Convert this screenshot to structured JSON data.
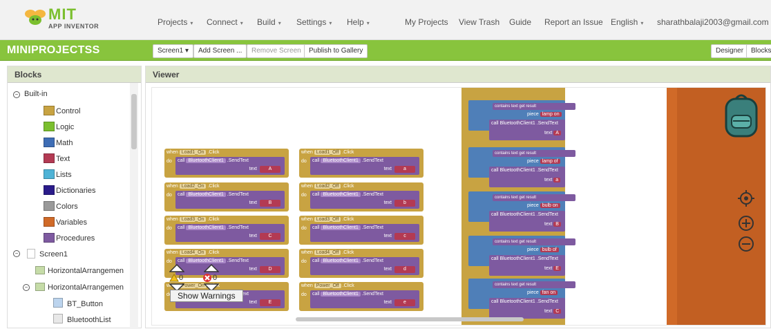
{
  "header": {
    "logo_title": "MIT",
    "logo_sub": "APP INVENTOR",
    "nav": [
      "Projects",
      "Connect",
      "Build",
      "Settings",
      "Help"
    ],
    "links": [
      "My Projects",
      "View Trash",
      "Guide",
      "Report an Issue"
    ],
    "language": "English",
    "account": "sharathbalaji2003@gmail.com"
  },
  "toolbar": {
    "project_name": "MINIPROJECTSS",
    "screen": "Screen1",
    "add_screen": "Add Screen ...",
    "remove_screen": "Remove Screen",
    "publish": "Publish to Gallery",
    "designer": "Designer",
    "blocks": "Blocks"
  },
  "blocks_panel": {
    "title": "Blocks",
    "builtin": "Built-in",
    "items": [
      {
        "label": "Control",
        "color": "#c8a342"
      },
      {
        "label": "Logic",
        "color": "#7bbf2e"
      },
      {
        "label": "Math",
        "color": "#3e6db5"
      },
      {
        "label": "Text",
        "color": "#b33a53"
      },
      {
        "label": "Lists",
        "color": "#4fb3d6"
      },
      {
        "label": "Dictionaries",
        "color": "#2a1b8a"
      },
      {
        "label": "Colors",
        "color": "#9a9a9a"
      },
      {
        "label": "Variables",
        "color": "#d06a28"
      },
      {
        "label": "Procedures",
        "color": "#7e5aa0"
      }
    ],
    "screen": "Screen1",
    "components": [
      "HorizontalArrangemen",
      "HorizontalArrangemen",
      "BT_Button",
      "BluetoothList"
    ]
  },
  "viewer": {
    "title": "Viewer",
    "events": [
      {
        "component": "Load1_On",
        "text": "A"
      },
      {
        "component": "Load1_Off",
        "text": "a"
      },
      {
        "component": "Load2_On",
        "text": "B"
      },
      {
        "component": "Load2_Off",
        "text": "b"
      },
      {
        "component": "Load3_On",
        "text": "C"
      },
      {
        "component": "Load3_Off",
        "text": "c"
      },
      {
        "component": "Load4_On",
        "text": "D"
      },
      {
        "component": "Load4_Off",
        "text": "d"
      },
      {
        "component": "Power_On",
        "text": "E"
      },
      {
        "component": "Power_Off",
        "text": "e"
      }
    ],
    "speech": [
      {
        "piece": "lamp on",
        "text": "A"
      },
      {
        "piece": "lamp of",
        "text": "a"
      },
      {
        "piece": "bulb on",
        "text": "B"
      },
      {
        "piece": "bulb of",
        "text": "E"
      },
      {
        "piece": "fan on",
        "text": "C"
      }
    ],
    "warnings_count": "0",
    "errors_count": "0",
    "show_warnings": "Show Warnings"
  }
}
